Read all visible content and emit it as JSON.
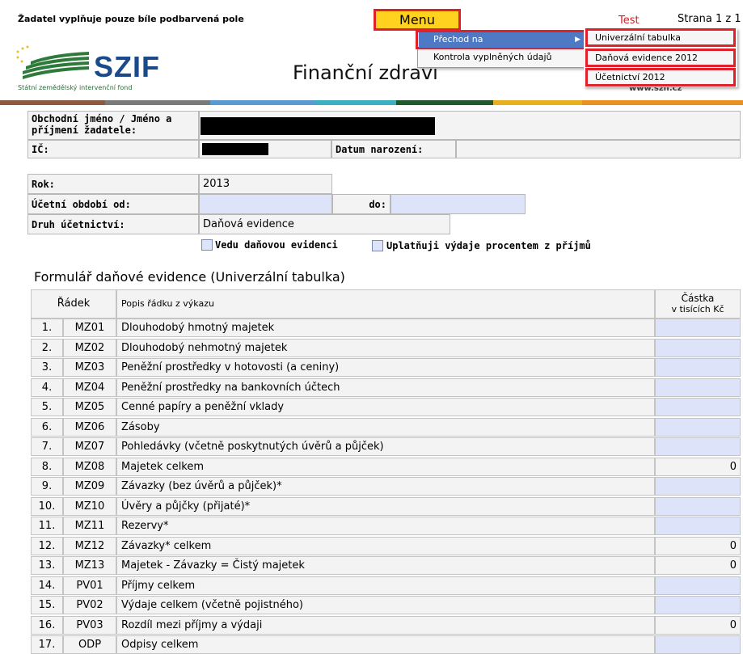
{
  "header": {
    "instruction": "Žadatel vyplňuje pouze bíle podbarvená pole",
    "menu_label": "Menu",
    "test_label": "Test",
    "page_indicator": "Strana 1 z 1",
    "logo_text": "SZIF",
    "logo_subtitle": "Státní zemědělský intervenční fond",
    "title": "Finanční zdraví",
    "website": "www.szif.cz"
  },
  "menu": {
    "items": [
      {
        "label": "Přechod na",
        "has_submenu": true,
        "highlighted": true
      },
      {
        "label": "Kontrola vyplněných údajů"
      }
    ],
    "submenu": [
      {
        "label": "Univerzální tabulka"
      },
      {
        "label": "Daňová evidence 2012"
      },
      {
        "label": "Účetnictví 2012"
      }
    ]
  },
  "applicant": {
    "name_label": "Obchodní jméno / Jméno a příjmení žadatele:",
    "ic_label": "IČ:",
    "birth_label": "Datum narození:"
  },
  "period": {
    "rok_label": "Rok:",
    "rok_value": "2013",
    "obdobi_label": "Účetní období od:",
    "do_label": "do:",
    "druh_label": "Druh účetnictví:",
    "druh_value": "Daňová evidence",
    "check1_label": "Vedu daňovou evidenci",
    "check2_label": "Uplatňuji výdaje procentem z příjmů"
  },
  "section_title": "Formulář daňové evidence (Univerzální tabulka)",
  "table": {
    "columns": [
      "Řádek",
      "Popis řádku z výkazu",
      "Částka",
      "v tisících Kč"
    ],
    "rows": [
      {
        "num": "1.",
        "code": "MZ01",
        "desc": "Dlouhodobý hmotný majetek",
        "value": ""
      },
      {
        "num": "2.",
        "code": "MZ02",
        "desc": "Dlouhodobý nehmotný majetek",
        "value": ""
      },
      {
        "num": "3.",
        "code": "MZ03",
        "desc": "Peněžní prostředky v hotovosti (a ceniny)",
        "value": ""
      },
      {
        "num": "4.",
        "code": "MZ04",
        "desc": "Peněžní prostředky na bankovních účtech",
        "value": ""
      },
      {
        "num": "5.",
        "code": "MZ05",
        "desc": "Cenné papíry a peněžní vklady",
        "value": ""
      },
      {
        "num": "6.",
        "code": "MZ06",
        "desc": "Zásoby",
        "value": ""
      },
      {
        "num": "7.",
        "code": "MZ07",
        "desc": "Pohledávky (včetně poskytnutých úvěrů a půjček)",
        "value": ""
      },
      {
        "num": "8.",
        "code": "MZ08",
        "desc": "Majetek celkem",
        "value": "0"
      },
      {
        "num": "9.",
        "code": "MZ09",
        "desc": "Závazky (bez úvěrů a půjček)*",
        "value": ""
      },
      {
        "num": "10.",
        "code": "MZ10",
        "desc": "Úvěry a půjčky (přijaté)*",
        "value": ""
      },
      {
        "num": "11.",
        "code": "MZ11",
        "desc": "Rezervy*",
        "value": ""
      },
      {
        "num": "12.",
        "code": "MZ12",
        "desc": "Závazky* celkem",
        "value": "0"
      },
      {
        "num": "13.",
        "code": "MZ13",
        "desc": "Majetek - Závazky = Čistý majetek",
        "value": "0"
      },
      {
        "num": "14.",
        "code": "PV01",
        "desc": "Příjmy celkem",
        "value": ""
      },
      {
        "num": "15.",
        "code": "PV02",
        "desc": "Výdaje celkem (včetně pojistného)",
        "value": ""
      },
      {
        "num": "16.",
        "code": "PV03",
        "desc": "Rozdíl mezi příjmy a výdaji",
        "value": "0"
      },
      {
        "num": "17.",
        "code": "ODP",
        "desc": "Odpisy celkem",
        "value": ""
      }
    ]
  },
  "colors": {
    "menu_bg": "#ffd21f",
    "highlight_red": "#e0202a",
    "input_blue": "#dde3f9",
    "menu_selected": "#4e79c5"
  }
}
